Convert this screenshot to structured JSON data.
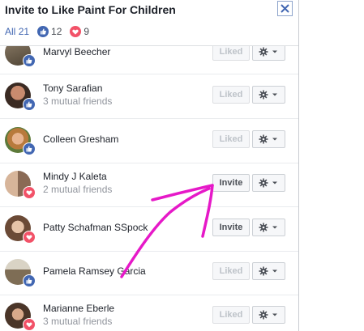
{
  "header": {
    "title": "Invite to Like Paint For Children",
    "close_icon": "close-icon"
  },
  "tabs": {
    "all_label": "All",
    "all_count": "21",
    "like_count": "12",
    "love_count": "9"
  },
  "buttons": {
    "liked_label": "Liked",
    "invite_label": "Invite"
  },
  "people": [
    {
      "name": "Marvyl Beecher",
      "sub": "",
      "reaction": "like",
      "action": "Liked"
    },
    {
      "name": "Tony Sarafian",
      "sub": "3 mutual friends",
      "reaction": "like",
      "action": "Liked"
    },
    {
      "name": "Colleen Gresham",
      "sub": "",
      "reaction": "like",
      "action": "Liked"
    },
    {
      "name": "Mindy J Kaleta",
      "sub": "2 mutual friends",
      "reaction": "love",
      "action": "Invite"
    },
    {
      "name": "Patty Schafman SSpock",
      "sub": "",
      "reaction": "love",
      "action": "Invite"
    },
    {
      "name": "Pamela Ramsey Garcia",
      "sub": "",
      "reaction": "like",
      "action": "Liked"
    },
    {
      "name": "Marianne Eberle",
      "sub": "3 mutual friends",
      "reaction": "love",
      "action": "Liked"
    }
  ],
  "colors": {
    "like_blue": "#4267b2",
    "love_red": "#f25268",
    "annotation_magenta": "#e619c8"
  }
}
